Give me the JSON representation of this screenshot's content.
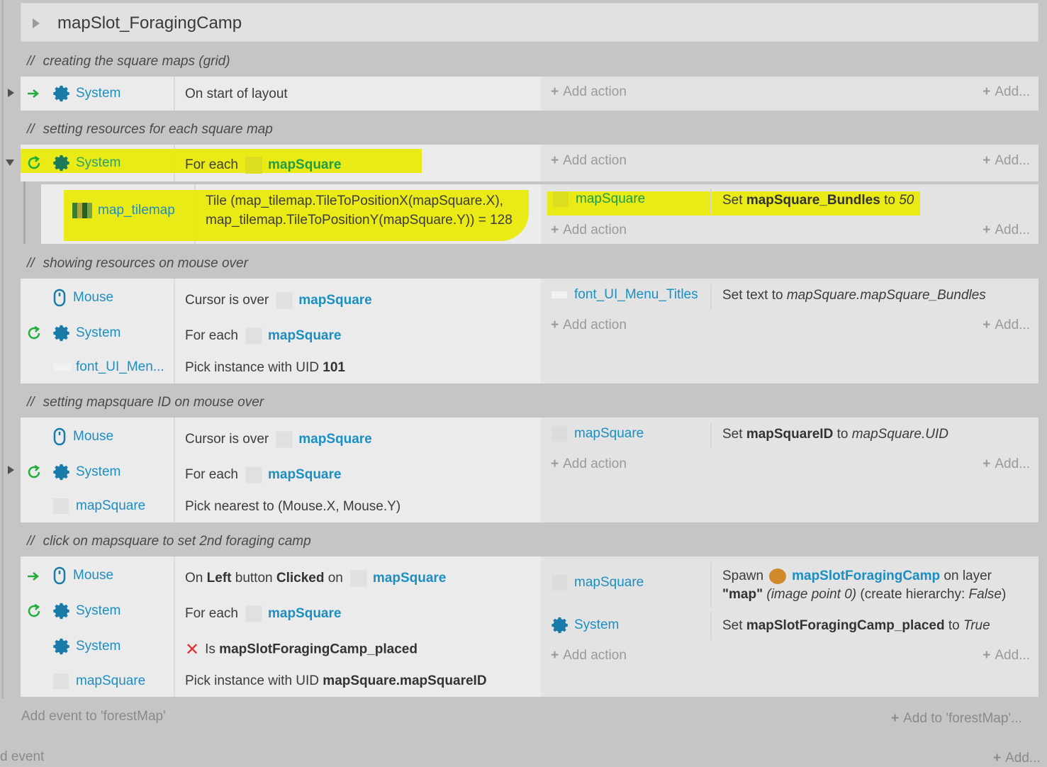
{
  "group": {
    "title": "mapSlot_ForagingCamp"
  },
  "comments": [
    "creating the square maps (grid)",
    "setting resources for each square map",
    "showing resources on mouse over",
    "setting mapsquare ID on mouse over",
    "click on mapsquare to set 2nd foraging camp"
  ],
  "comment_prefix": "//",
  "labels": {
    "system": "System",
    "mouse": "Mouse",
    "map_tilemap": "map_tilemap",
    "font_short": "font_UI_Men...",
    "font_full": "font_UI_Menu_Titles",
    "mapSquare": "mapSquare",
    "add_action": "Add action",
    "add_short": "Add...",
    "for_each": "For each",
    "cursor_over": "Cursor is over",
    "pick_uid": "Pick instance with UID",
    "set": "Set",
    "to": "to",
    "set_text_to": "Set text to",
    "on_start": "On start of layout",
    "on": "On",
    "left": "Left",
    "button": "button",
    "clicked": "Clicked",
    "on_word": "on",
    "is": "Is",
    "spawn": "Spawn",
    "on_layer": "on layer",
    "pick_nearest": "Pick nearest to (Mouse.X, Mouse.Y)"
  },
  "event2": {
    "tile_line1": "Tile (map_tilemap.TileToPositionX(mapSquare.X),",
    "tile_line2": "map_tilemap.TileToPositionY(mapSquare.Y)) = 128",
    "set_var": "mapSquare_Bundles",
    "set_val": "50"
  },
  "event3": {
    "uid": "101",
    "text_expr": "mapSquare.mapSquare_Bundles"
  },
  "event4": {
    "set_var": "mapSquareID",
    "set_val": "mapSquare.UID"
  },
  "event5": {
    "var": "mapSlotForagingCamp_placed",
    "uid_expr": "mapSquare.mapSquareID",
    "spawn_obj": "mapSlotForagingCamp",
    "layer": "\"map\"",
    "spawn_rest_i": "(image point 0)",
    "spawn_rest_a": "(create hierarchy: ",
    "spawn_false": "False",
    "spawn_close": ")",
    "set_true": "True"
  },
  "footer": {
    "add_event": "Add event to 'forestMap'",
    "add_to": "Add to 'forestMap'...",
    "d_event": "d event",
    "add_bottom": "Add..."
  },
  "colors": {
    "link": "#1b8fc2",
    "highlight": "#eaea00",
    "event_bg": "#ebebeb",
    "page_bg": "#c5c5c5"
  }
}
